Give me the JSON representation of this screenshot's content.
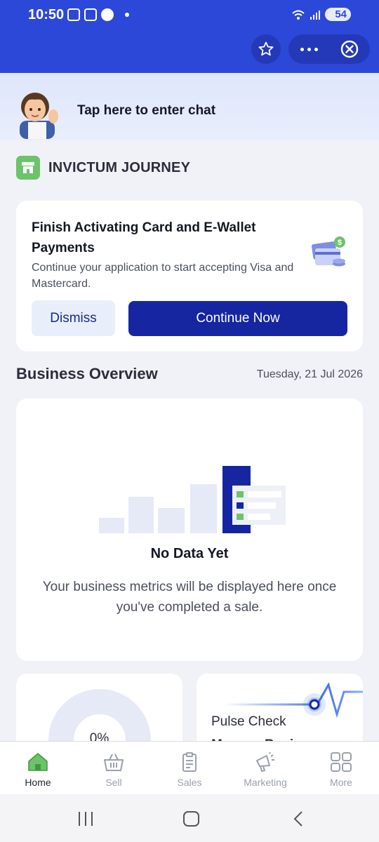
{
  "status_bar": {
    "time": "10:50",
    "battery": "54",
    "icons": [
      "screenshot-icon",
      "shop-icon",
      "vpn-icon",
      "wifi-icon",
      "signal-icon"
    ]
  },
  "header": {
    "star_icon": "star-outline-icon",
    "more_icon": "more-dots-icon",
    "close_icon": "close-circle-icon",
    "color": "#2c48d8"
  },
  "chat_banner": {
    "label": "Tap here to enter chat"
  },
  "journey": {
    "title": "INVICTUM JOURNEY",
    "icon": "store-icon",
    "icon_color": "#6cc36a"
  },
  "activation_card": {
    "title": "Finish Activating Card and E-Wallet Payments",
    "description": "Continue your application to start accepting Visa and Mastercard.",
    "dismiss_label": "Dismiss",
    "continue_label": "Continue Now",
    "illustration": "cards-with-dollar-icon"
  },
  "business_overview": {
    "title": "Business Overview",
    "date": "Tuesday, 21 Jul 2026",
    "empty_title": "No Data Yet",
    "empty_description": "Your business metrics will be displayed here once you've completed a sale."
  },
  "metric_cards": {
    "left_value": "0%",
    "right_label": "Pulse Check",
    "right_sub": "Manage Business"
  },
  "bottom_nav": {
    "items": [
      {
        "label": "Home",
        "icon": "home-icon",
        "active": true
      },
      {
        "label": "Sell",
        "icon": "basket-icon",
        "active": false
      },
      {
        "label": "Sales",
        "icon": "clipboard-icon",
        "active": false
      },
      {
        "label": "Marketing",
        "icon": "megaphone-icon",
        "active": false
      },
      {
        "label": "More",
        "icon": "grid-icon",
        "active": false
      }
    ]
  },
  "colors": {
    "primary": "#1626a0",
    "accent_green": "#6cc36a",
    "header_blue": "#2c48d8"
  }
}
